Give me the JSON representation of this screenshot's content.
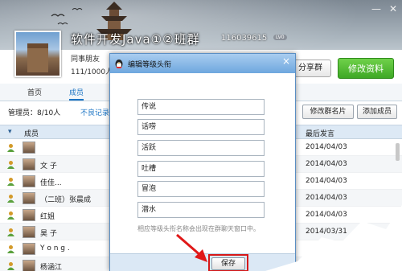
{
  "header": {
    "group_name": "软件开发Java①②班群",
    "group_number": "116039615",
    "level_badge": "LV0",
    "subline1": "同事朋友",
    "subline2": "111/1000人",
    "share_button": "分享群",
    "edit_button": "修改资料"
  },
  "tabs": [
    {
      "label": "首页"
    },
    {
      "label": "成员"
    }
  ],
  "toolbar": {
    "admins": "管理员：8/10人",
    "bad_records": "不良记录",
    "edit_card": "修改群名片",
    "add_member": "添加成员"
  },
  "table": {
    "col_member": "成员",
    "col_last_post": "最后发言",
    "rows": [
      {
        "name": "",
        "date": "2014/04/03"
      },
      {
        "name": "文 子",
        "date": "2014/04/03"
      },
      {
        "name": "佳佳...",
        "date": "2014/04/03"
      },
      {
        "name": "（二班）张晨成",
        "date": "2014/04/03"
      },
      {
        "name": "红姐",
        "date": "2014/04/03"
      },
      {
        "name": "昊 子",
        "date": "2014/03/31"
      },
      {
        "name": "Y o n g .",
        "date": ""
      },
      {
        "name": "杨涵江",
        "date": ""
      }
    ]
  },
  "dialog": {
    "title": "编辑等级头衔",
    "close": "×",
    "levels": [
      "传说",
      "话唠",
      "活跃",
      "吐槽",
      "冒泡",
      "潜水"
    ],
    "hint": "相应等级头衔名称会出现在群聊天窗口中。",
    "save_button": "保存"
  },
  "colors": {
    "accent": "#1b74c4",
    "primary_button": "#3ea825",
    "highlight": "#d61818"
  }
}
